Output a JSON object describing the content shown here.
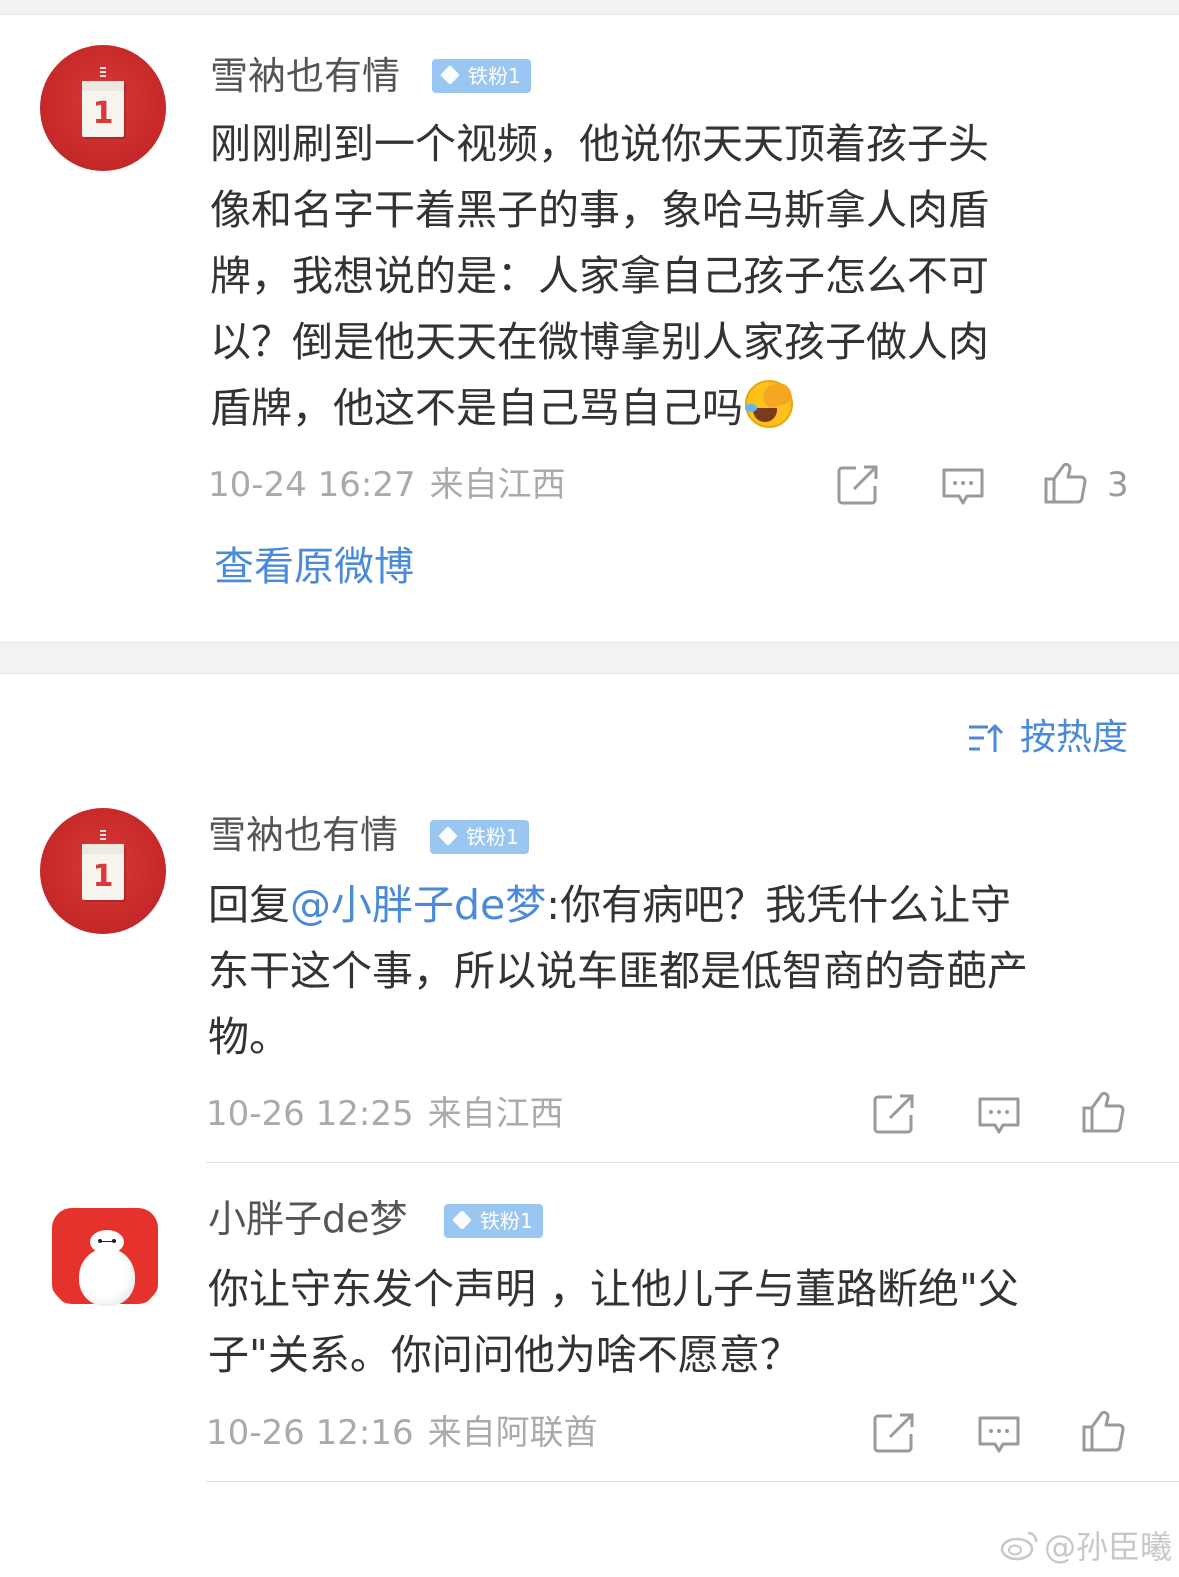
{
  "post_comment": {
    "user_name": "雪衲也有情",
    "badge": "铁粉1",
    "text_lines": [
      "刚刚刷到一个视频，他说你天天顶着孩子头",
      "像和名字干着黑子的事，象哈马斯拿人肉盾",
      "牌，我想说的是：人家拿自己孩子怎么不可",
      "以？倒是他天天在微博拿别人家孩子做人肉",
      "盾牌，他这不是自己骂自己吗"
    ],
    "emoji": "laughing-crying-emoji",
    "time": "10-24 16:27",
    "location": "来自江西",
    "like_count": "3",
    "view_original": "查看原微博",
    "avatar_text": "1"
  },
  "sort": {
    "label": "按热度"
  },
  "replies": [
    {
      "user_name": "雪衲也有情",
      "badge": "铁粉1",
      "prefix": "回复",
      "mention": "@小胖子de梦",
      "text_first": ":你有病吧？我凭什么让守",
      "text_lines": [
        "东干这个事，所以说车匪都是低智商的奇葩产",
        "物。"
      ],
      "time": "10-26 12:25",
      "location": "来自江西",
      "avatar_text": "1"
    },
    {
      "user_name": "小胖子de梦",
      "badge": "铁粉1",
      "text_lines": [
        "你让守东发个声明 ，让他儿子与董路断绝\"父",
        "子\"关系。你问问他为啥不愿意？"
      ],
      "time": "10-26 12:16",
      "location": "来自阿联酋"
    }
  ],
  "watermark": "@孙臣曦",
  "colors": {
    "link": "#4a8ad8",
    "badge": "#9ac6f2",
    "meta": "#aaaaaa",
    "text": "#333333"
  },
  "icons": [
    "share-icon",
    "comment-icon",
    "like-icon",
    "sort-icon",
    "weibo-logo-icon"
  ]
}
